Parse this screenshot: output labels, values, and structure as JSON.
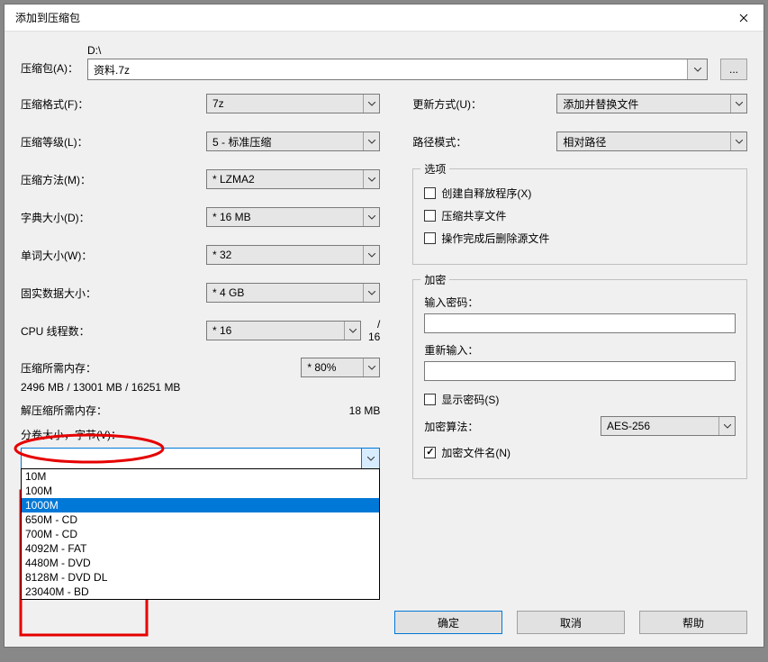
{
  "title": "添加到压缩包",
  "archive": {
    "label": "压缩包(A)：",
    "path_top": "D:\\",
    "filename": "资料.7z",
    "browse": "..."
  },
  "left": {
    "format": {
      "label": "压缩格式(F)：",
      "value": "7z"
    },
    "level": {
      "label": "压缩等级(L)：",
      "value": "5 - 标准压缩"
    },
    "method": {
      "label": "压缩方法(M)：",
      "value": "* LZMA2"
    },
    "dict": {
      "label": "字典大小(D)：",
      "value": "* 16 MB"
    },
    "word": {
      "label": "单词大小(W)：",
      "value": "* 32"
    },
    "solid": {
      "label": "固实数据大小：",
      "value": "* 4 GB"
    },
    "threads": {
      "label": "CPU 线程数：",
      "value": "* 16",
      "max": "/ 16"
    },
    "mem_compress": {
      "label": "压缩所需内存：",
      "percent": "* 80%",
      "detail": "2496 MB / 13001 MB / 16251 MB"
    },
    "mem_decompress": {
      "label": "解压缩所需内存：",
      "value": "18 MB"
    },
    "split": {
      "label": "分卷大小，字节(V)：",
      "value": "",
      "options": [
        "10M",
        "100M",
        "1000M",
        "650M - CD",
        "700M - CD",
        "4092M - FAT",
        "4480M - DVD",
        "8128M - DVD DL",
        "23040M - BD"
      ],
      "selected": "1000M"
    }
  },
  "right": {
    "update": {
      "label": "更新方式(U)：",
      "value": "添加并替换文件"
    },
    "pathmode": {
      "label": "路径模式：",
      "value": "相对路径"
    },
    "options": {
      "legend": "选项",
      "sfx": "创建自释放程序(X)",
      "shared": "压缩共享文件",
      "deleteafter": "操作完成后删除源文件"
    },
    "encrypt": {
      "legend": "加密",
      "pwd": "输入密码：",
      "pwd2": "重新输入：",
      "show": "显示密码(S)",
      "algo_label": "加密算法：",
      "algo_value": "AES-256",
      "encnames": "加密文件名(N)"
    }
  },
  "buttons": {
    "ok": "确定",
    "cancel": "取消",
    "help": "帮助"
  }
}
